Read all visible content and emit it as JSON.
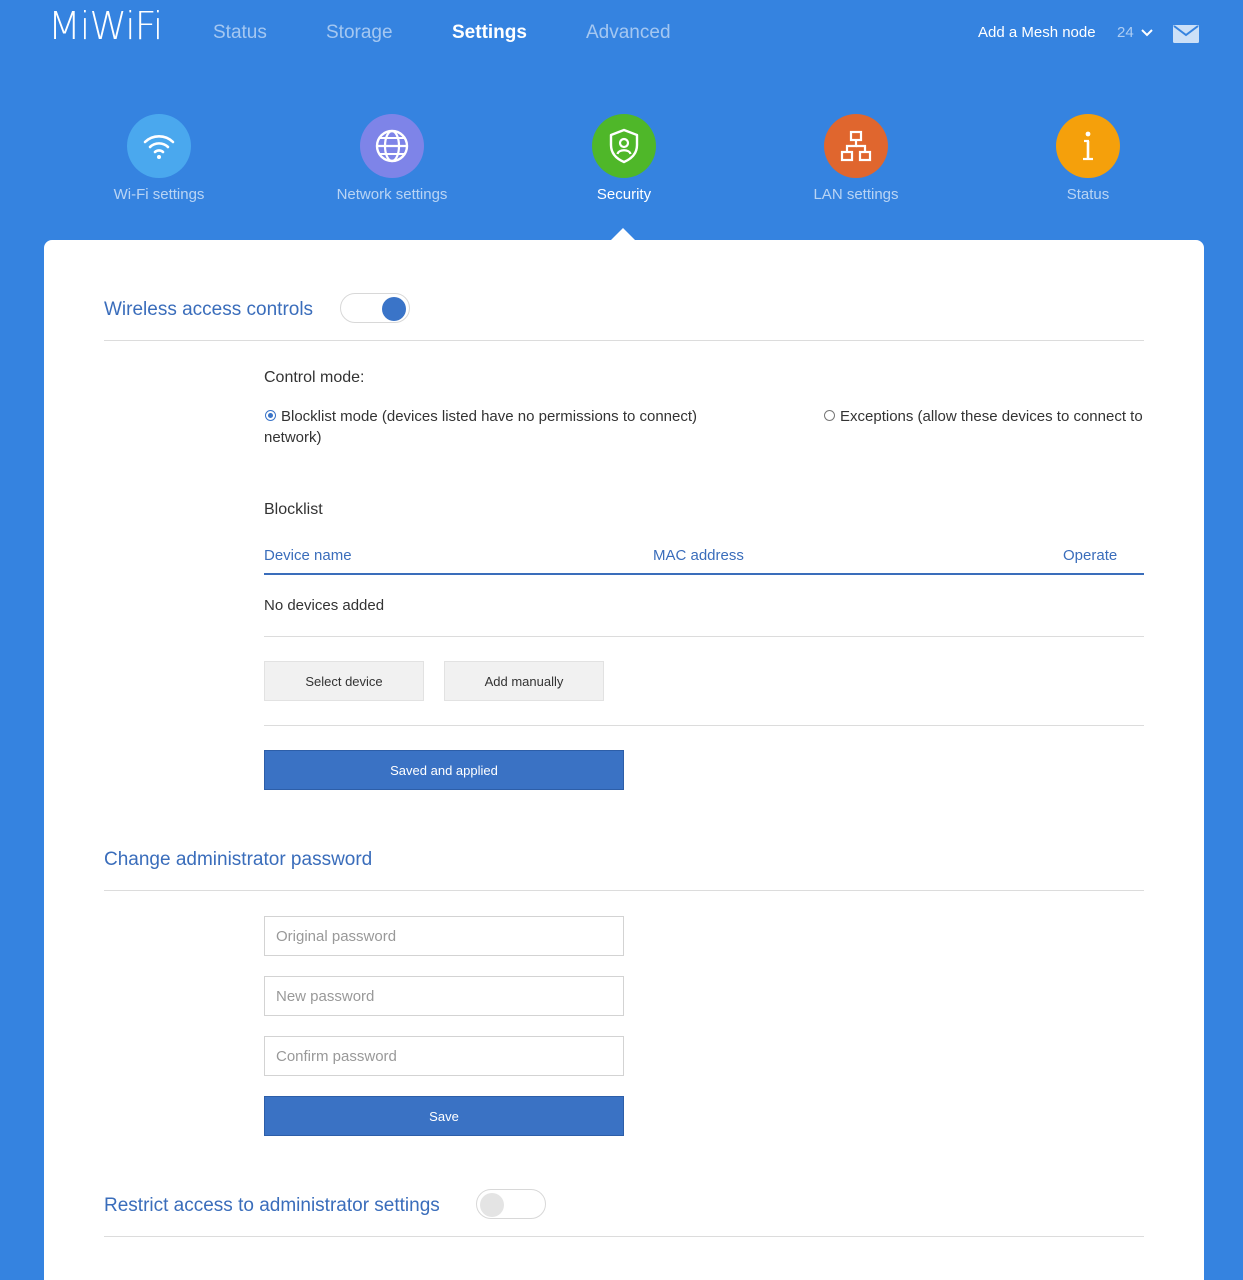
{
  "brand": {
    "logo": "MiWiFi"
  },
  "nav": {
    "tabs": [
      {
        "label": "Status"
      },
      {
        "label": "Storage"
      },
      {
        "label": "Settings",
        "active": true
      },
      {
        "label": "Advanced"
      }
    ],
    "mesh_link": "Add a Mesh node",
    "count": "24",
    "icons": [
      "chevron-down-icon",
      "mail-icon"
    ]
  },
  "categories": [
    {
      "label": "Wi-Fi settings",
      "icon": "wifi-icon",
      "color": "#4aa8ee"
    },
    {
      "label": "Network settings",
      "icon": "globe-icon",
      "color": "#7e84e8"
    },
    {
      "label": "Security",
      "icon": "shield-user-icon",
      "color": "#4fb729",
      "active": true
    },
    {
      "label": "LAN settings",
      "icon": "network-tree-icon",
      "color": "#e0662e"
    },
    {
      "label": "Status",
      "icon": "info-icon",
      "color": "#f5a00b"
    }
  ],
  "wireless": {
    "title": "Wireless access controls",
    "toggle_on": true,
    "control_mode_label": "Control mode:",
    "blocklist_option": "Blocklist mode (devices listed have no permissions to connect)",
    "blocklist_option_wrap": "network)",
    "exceptions_option": "Exceptions (allow these devices to connect to",
    "selected_mode": "blocklist",
    "blocklist_title": "Blocklist",
    "columns": [
      "Device name",
      "MAC address",
      "Operate"
    ],
    "empty_text": "No devices added",
    "select_device_label": "Select device",
    "add_manually_label": "Add manually",
    "apply_label": "Saved and applied"
  },
  "password": {
    "title": "Change administrator password",
    "original_placeholder": "Original password",
    "new_placeholder": "New password",
    "confirm_placeholder": "Confirm password",
    "save_label": "Save"
  },
  "restrict": {
    "title": "Restrict access to administrator settings",
    "toggle_on": false
  },
  "colors": {
    "background": "#3583e0",
    "accent": "#3a72c4",
    "title": "#3a6dbb"
  }
}
